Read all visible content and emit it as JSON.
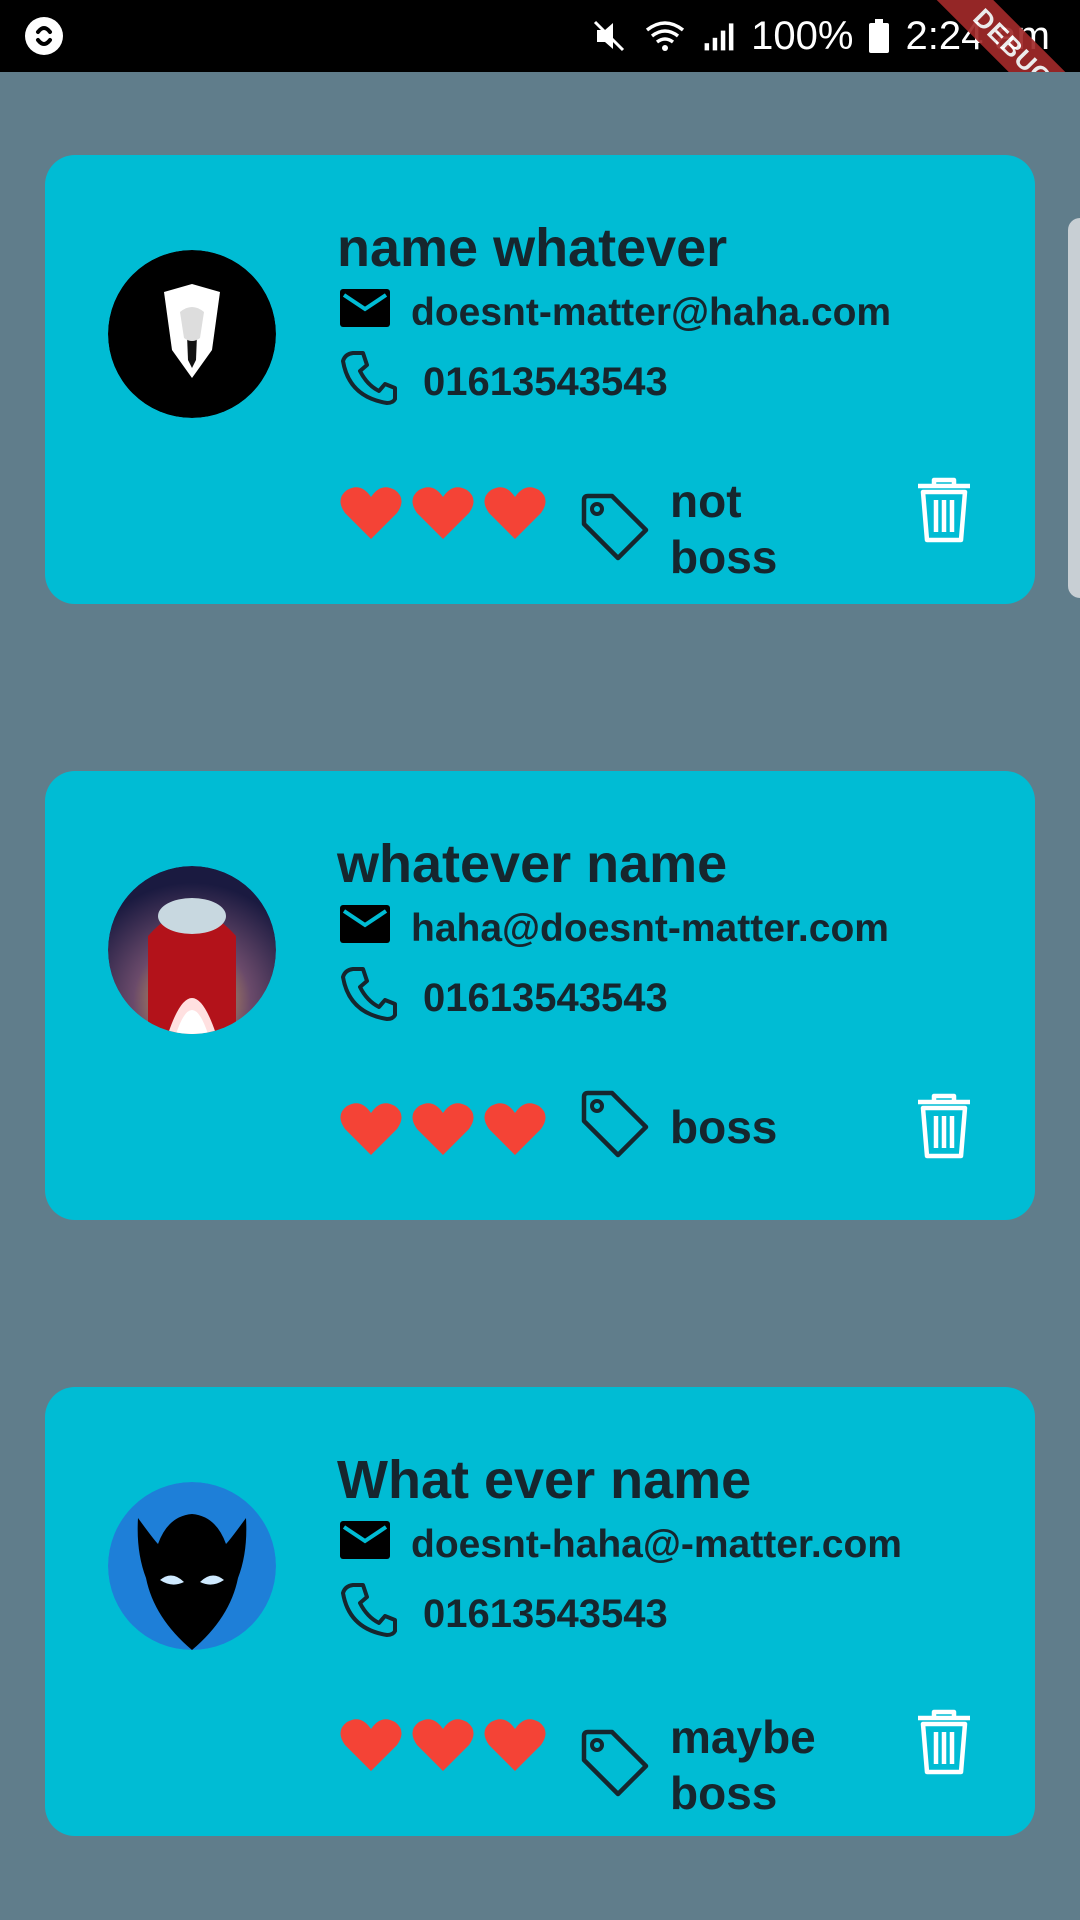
{
  "status_bar": {
    "battery": "100%",
    "time": "2:24 am",
    "debug_banner": "DEBUG"
  },
  "contacts": [
    {
      "name": "name whatever",
      "email": "doesnt-matter@haha.com",
      "phone": "01613543543",
      "hearts": 3,
      "tag": "not boss",
      "avatar": "suit-man-avatar"
    },
    {
      "name": "whatever name",
      "email": "haha@doesnt-matter.com",
      "phone": "01613543543",
      "hearts": 3,
      "tag": "boss",
      "avatar": "red-crewmate-avatar"
    },
    {
      "name": "What ever name",
      "email": "doesnt-haha@-matter.com",
      "phone": "01613543543",
      "hearts": 3,
      "tag": "maybe boss",
      "avatar": "horned-shadow-avatar"
    }
  ],
  "colors": {
    "background": "#607d8b",
    "card": "#00bcd4",
    "heart": "#f44336",
    "text": "#16262e",
    "delete_icon": "#ffffff"
  }
}
